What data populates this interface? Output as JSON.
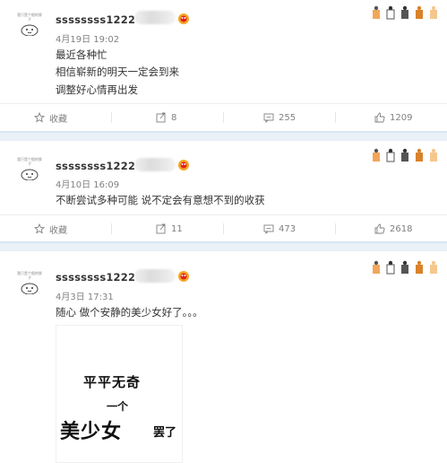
{
  "posts": [
    {
      "avatar_caption": "我只是个假的胖子",
      "username": "ssssssss1222",
      "time": "4月19日 19:02",
      "lines": [
        "最近各种忙",
        "相信崭新的明天一定会到来",
        "调整好心情再出发"
      ],
      "actions": {
        "favorite": "收藏",
        "repost": "8",
        "comment": "255",
        "like": "1209"
      }
    },
    {
      "avatar_caption": "我只是个假的胖子",
      "username": "ssssssss1222",
      "time": "4月10日 16:09",
      "lines": [
        "不断尝试多种可能 说不定会有意想不到的收获"
      ],
      "actions": {
        "favorite": "收藏",
        "repost": "11",
        "comment": "473",
        "like": "2618"
      }
    },
    {
      "avatar_caption": "我只是个假的胖子",
      "username": "ssssssss1222",
      "time": "4月3日 17:31",
      "lines": [
        "随心 做个安静的美少女好了。。。"
      ],
      "image_text": {
        "line1": "平平无奇",
        "line2": "一个",
        "line3": "美少女",
        "line4": "罢了"
      }
    }
  ],
  "colors": {
    "separator": "#eaf1f7",
    "meta": "#808080",
    "text": "#333333"
  },
  "icons": [
    "star-icon",
    "repost-icon",
    "comment-icon",
    "thumbs-up-icon",
    "verified-badge-icon",
    "cat-paw-icon"
  ]
}
